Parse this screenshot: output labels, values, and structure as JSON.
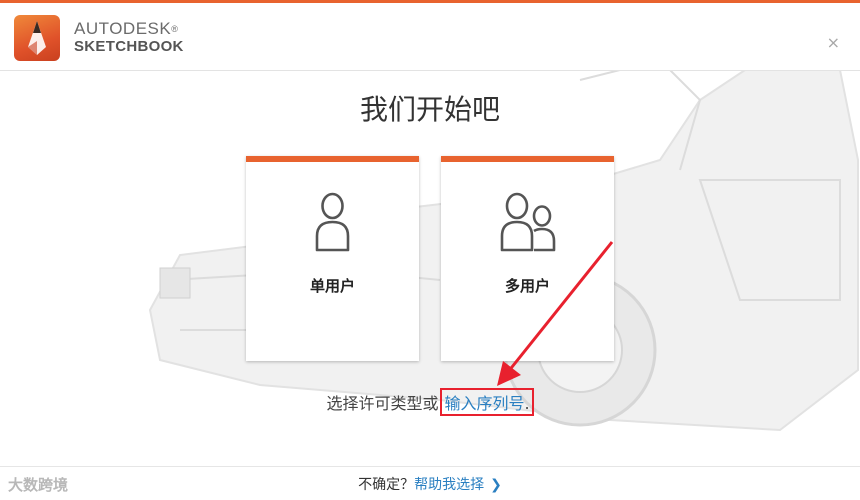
{
  "brand": {
    "line1": "AUTODESK",
    "line2": "SKETCHBOOK",
    "mark": "®"
  },
  "window": {
    "close_glyph": "×"
  },
  "main": {
    "title": "我们开始吧",
    "cards": [
      {
        "label": "单用户",
        "icon": "single-user-icon"
      },
      {
        "label": "多用户",
        "icon": "multi-user-icon"
      }
    ],
    "license_prompt": "选择许可类型或",
    "serial_link": "输入序列号",
    "serial_suffix": "."
  },
  "footer": {
    "question": "不确定？",
    "help_link": "帮助我选择",
    "chevron": "❯"
  },
  "watermark": {
    "text": "大数跨境"
  },
  "colors": {
    "accent": "#e8632f",
    "link": "#2a7fc1",
    "annotation_red": "#e8212e"
  }
}
